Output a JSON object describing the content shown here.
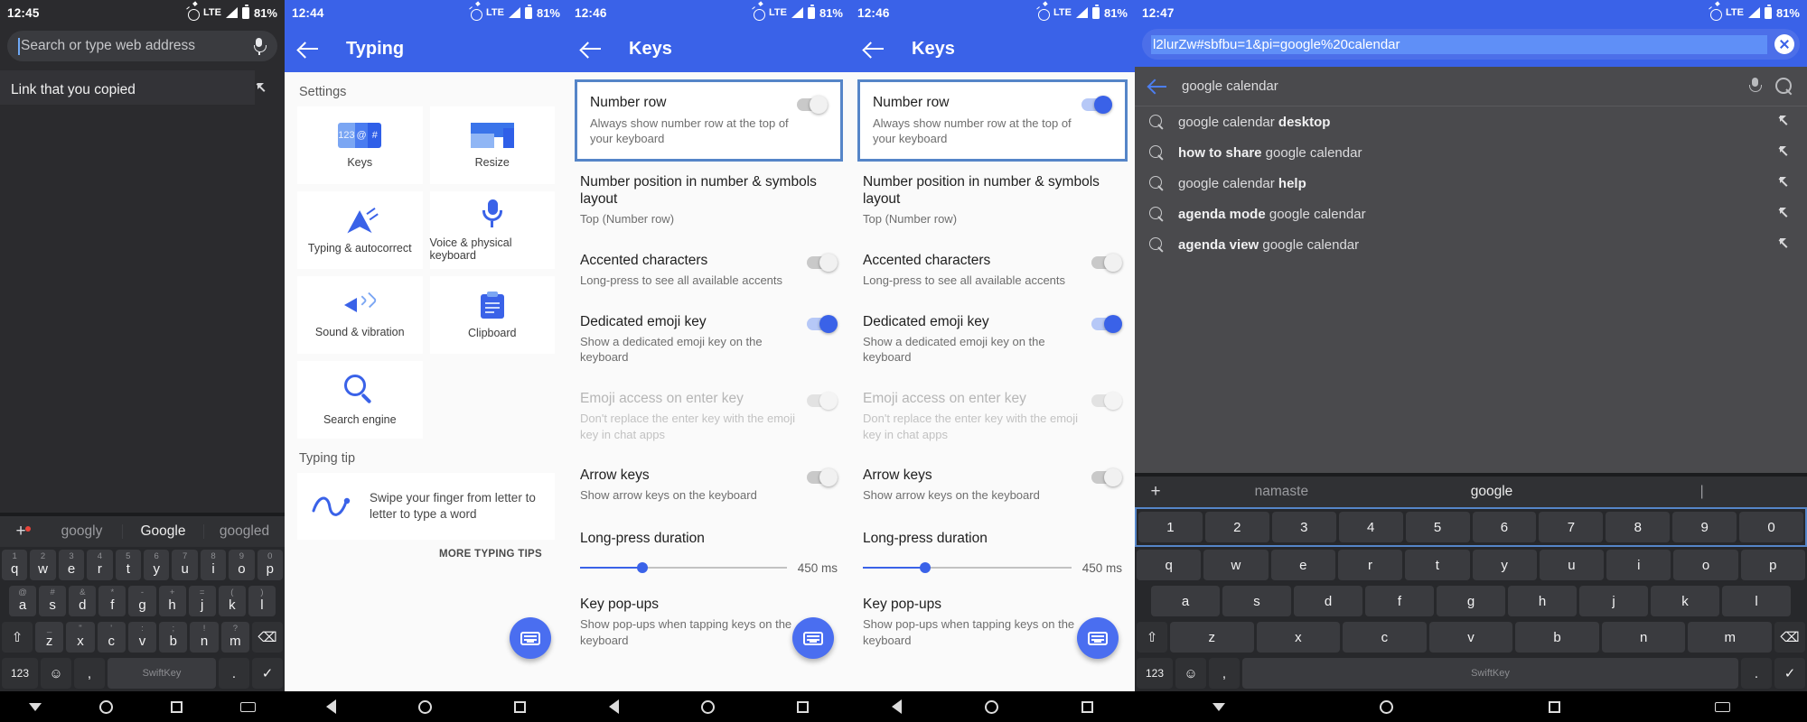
{
  "panel1": {
    "status": {
      "time": "12:45",
      "network": "LTE",
      "battery": "81%"
    },
    "omnibox": {
      "placeholder": "Search or type web address",
      "mic_icon": "microphone-icon"
    },
    "suggestion": {
      "text": "Link that you copied"
    },
    "keyboard": {
      "predictions": [
        "googly",
        "Google",
        "googled"
      ],
      "row1": [
        {
          "key": "q",
          "hint": "1"
        },
        {
          "key": "w",
          "hint": "2"
        },
        {
          "key": "e",
          "hint": "3"
        },
        {
          "key": "r",
          "hint": "4"
        },
        {
          "key": "t",
          "hint": "5"
        },
        {
          "key": "y",
          "hint": "6"
        },
        {
          "key": "u",
          "hint": "7"
        },
        {
          "key": "i",
          "hint": "8"
        },
        {
          "key": "o",
          "hint": "9"
        },
        {
          "key": "p",
          "hint": "0"
        }
      ],
      "row2": [
        {
          "key": "a",
          "hint": "@"
        },
        {
          "key": "s",
          "hint": "#"
        },
        {
          "key": "d",
          "hint": "&"
        },
        {
          "key": "f",
          "hint": "*"
        },
        {
          "key": "g",
          "hint": "-"
        },
        {
          "key": "h",
          "hint": "+"
        },
        {
          "key": "j",
          "hint": "="
        },
        {
          "key": "k",
          "hint": "("
        },
        {
          "key": "l",
          "hint": ")"
        }
      ],
      "row3": [
        {
          "key": "z",
          "hint": "_"
        },
        {
          "key": "x",
          "hint": "\""
        },
        {
          "key": "c",
          "hint": "'"
        },
        {
          "key": "v",
          "hint": ":"
        },
        {
          "key": "b",
          "hint": ";"
        },
        {
          "key": "n",
          "hint": "!"
        },
        {
          "key": "m",
          "hint": "?"
        }
      ],
      "shift_label": "shift-icon",
      "backspace_label": "backspace-icon",
      "numeric_label": "123",
      "emoji_label": "emoji-icon",
      "comma_label": ",",
      "space_label": "SwiftKey",
      "period_label": ".",
      "enter_label": "enter-icon"
    },
    "navbar": {
      "back": "back-icon",
      "home": "home-icon",
      "recents": "recents-icon",
      "keyboard": "keyboard-icon"
    }
  },
  "panel2": {
    "status": {
      "time": "12:44",
      "network": "LTE",
      "battery": "81%"
    },
    "appbar": {
      "back": "back-arrow-icon",
      "title": "Typing"
    },
    "section_label": "Settings",
    "tiles": [
      {
        "label": "Keys",
        "icon": "keys-icon",
        "icon_text": [
          "123",
          "@",
          "#"
        ]
      },
      {
        "label": "Resize",
        "icon": "resize-icon"
      },
      {
        "label": "Typing & autocorrect",
        "icon": "autocorrect-icon"
      },
      {
        "label": "Voice & physical keyboard",
        "icon": "microphone-icon"
      },
      {
        "label": "Sound & vibration",
        "icon": "sound-icon"
      },
      {
        "label": "Clipboard",
        "icon": "clipboard-icon"
      },
      {
        "label": "Search engine",
        "icon": "search-icon"
      }
    ],
    "tip_section_label": "Typing tip",
    "tip": {
      "text": "Swipe your finger from letter to letter to type a word",
      "more": "MORE TYPING TIPS",
      "icon": "swipe-gesture-icon"
    },
    "fab": {
      "icon": "keyboard-icon"
    },
    "navbar": {
      "back": "back-icon",
      "home": "home-icon",
      "recents": "recents-icon"
    }
  },
  "panel3": {
    "status": {
      "time": "12:46",
      "network": "LTE",
      "battery": "81%"
    },
    "appbar": {
      "back": "back-arrow-icon",
      "title": "Keys"
    },
    "rows": [
      {
        "title": "Number row",
        "subtitle": "Always show number row at the top of your keyboard",
        "toggle": "off",
        "highlighted": true,
        "dim": false
      },
      {
        "title": "Number position in number & symbols layout",
        "subtitle": "Top (Number row)",
        "toggle": "none",
        "highlighted": false,
        "dim": false
      },
      {
        "title": "Accented characters",
        "subtitle": "Long-press to see all available accents",
        "toggle": "off",
        "highlighted": false,
        "dim": false
      },
      {
        "title": "Dedicated emoji key",
        "subtitle": "Show a dedicated emoji key on the keyboard",
        "toggle": "on",
        "highlighted": false,
        "dim": false
      },
      {
        "title": "Emoji access on enter key",
        "subtitle": "Don't replace the enter key with the emoji key in chat apps",
        "toggle": "dim",
        "highlighted": false,
        "dim": true
      },
      {
        "title": "Arrow keys",
        "subtitle": "Show arrow keys on the keyboard",
        "toggle": "off",
        "highlighted": false,
        "dim": false
      }
    ],
    "slider": {
      "title": "Long-press duration",
      "value": "450 ms",
      "percent": 30
    },
    "last_row": {
      "title": "Key pop-ups",
      "subtitle": "Show pop-ups when tapping keys on the keyboard"
    },
    "fab": {
      "icon": "keyboard-icon"
    },
    "navbar": {
      "back": "back-icon",
      "home": "home-icon",
      "recents": "recents-icon"
    }
  },
  "panel4": {
    "status": {
      "time": "12:46",
      "network": "LTE",
      "battery": "81%"
    },
    "appbar": {
      "back": "back-arrow-icon",
      "title": "Keys"
    },
    "rows": [
      {
        "title": "Number row",
        "subtitle": "Always show number row at the top of your keyboard",
        "toggle": "on",
        "highlighted": true,
        "dim": false
      },
      {
        "title": "Number position in number & symbols layout",
        "subtitle": "Top (Number row)",
        "toggle": "none",
        "highlighted": false,
        "dim": false
      },
      {
        "title": "Accented characters",
        "subtitle": "Long-press to see all available accents",
        "toggle": "off",
        "highlighted": false,
        "dim": false
      },
      {
        "title": "Dedicated emoji key",
        "subtitle": "Show a dedicated emoji key on the keyboard",
        "toggle": "on",
        "highlighted": false,
        "dim": false
      },
      {
        "title": "Emoji access on enter key",
        "subtitle": "Don't replace the enter key with the emoji key in chat apps",
        "toggle": "dim",
        "highlighted": false,
        "dim": true
      },
      {
        "title": "Arrow keys",
        "subtitle": "Show arrow keys on the keyboard",
        "toggle": "off",
        "highlighted": false,
        "dim": false
      }
    ],
    "slider": {
      "title": "Long-press duration",
      "value": "450 ms",
      "percent": 30
    },
    "last_row": {
      "title": "Key pop-ups",
      "subtitle": "Show pop-ups when tapping keys on the keyboard"
    },
    "fab": {
      "icon": "keyboard-icon"
    },
    "navbar": {
      "back": "back-icon",
      "home": "home-icon",
      "recents": "recents-icon"
    }
  },
  "panel5": {
    "status": {
      "time": "12:47",
      "network": "LTE",
      "battery": "81%"
    },
    "omnibox": {
      "url": "l2lurZw#sbfbu=1&pi=google%20calendar",
      "clear_icon": "clear-icon"
    },
    "search_header": {
      "back": "back-icon",
      "query": "google calendar",
      "mic": "microphone-icon",
      "search": "search-icon"
    },
    "suggestions": [
      {
        "plain": "google calendar ",
        "bold": "desktop",
        "bold_first": false
      },
      {
        "plain": " google calendar",
        "bold": "how to share",
        "bold_first": true
      },
      {
        "plain": "google calendar ",
        "bold": "help",
        "bold_first": false
      },
      {
        "plain": " google calendar",
        "bold": "agenda mode",
        "bold_first": true
      },
      {
        "plain": " google calendar",
        "bold": "agenda view",
        "bold_first": true
      }
    ],
    "keyboard": {
      "predictions": [
        "namaste",
        "google",
        "|"
      ],
      "number_row": [
        "1",
        "2",
        "3",
        "4",
        "5",
        "6",
        "7",
        "8",
        "9",
        "0"
      ],
      "row1": [
        "q",
        "w",
        "e",
        "r",
        "t",
        "y",
        "u",
        "i",
        "o",
        "p"
      ],
      "row2": [
        "a",
        "s",
        "d",
        "f",
        "g",
        "h",
        "j",
        "k",
        "l"
      ],
      "row3": [
        "z",
        "x",
        "c",
        "v",
        "b",
        "n",
        "m"
      ],
      "shift_label": "shift-icon",
      "backspace_label": "backspace-icon",
      "numeric_label": "123",
      "emoji_label": "emoji-icon",
      "comma_label": ",",
      "space_label": "SwiftKey",
      "period_label": ".",
      "enter_label": "enter-icon"
    },
    "navbar": {
      "back": "back-icon",
      "home": "home-icon",
      "recents": "recents-icon",
      "keyboard": "keyboard-icon"
    }
  }
}
